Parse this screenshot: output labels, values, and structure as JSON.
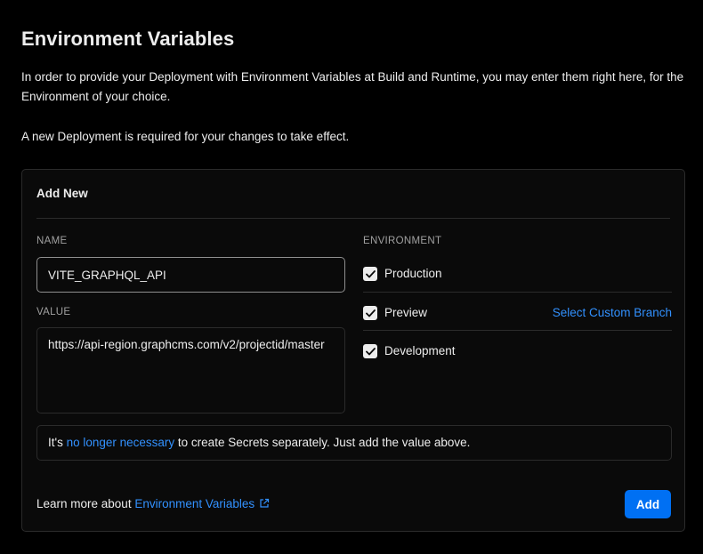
{
  "header": {
    "title": "Environment Variables",
    "description": "In order to provide your Deployment with Environment Variables at Build and Runtime, you may enter them right here, for the Environment of your choice.",
    "notice": "A new Deployment is required for your changes to take effect."
  },
  "form": {
    "title": "Add New",
    "name_label": "NAME",
    "name_value": "VITE_GRAPHQL_API",
    "value_label": "VALUE",
    "value_value": "https://api-region.graphcms.com/v2/projectid/master",
    "environment_label": "ENVIRONMENT",
    "environments": [
      {
        "label": "Production",
        "checked": true
      },
      {
        "label": "Preview",
        "checked": true
      },
      {
        "label": "Development",
        "checked": true
      }
    ],
    "custom_branch_link": "Select Custom Branch",
    "info": {
      "prefix": "It's ",
      "link": "no longer necessary",
      "suffix": " to create Secrets separately. Just add the value above."
    },
    "footer": {
      "prefix": "Learn more about ",
      "link": "Environment Variables",
      "link_icon": "external-link-icon"
    },
    "add_button": "Add"
  },
  "colors": {
    "background": "#000000",
    "card": "#0a0a0a",
    "border": "#2b2b2b",
    "link": "#3291ff",
    "primary_button": "#0070f3",
    "text": "#ededed",
    "muted": "#a0a0a0"
  }
}
